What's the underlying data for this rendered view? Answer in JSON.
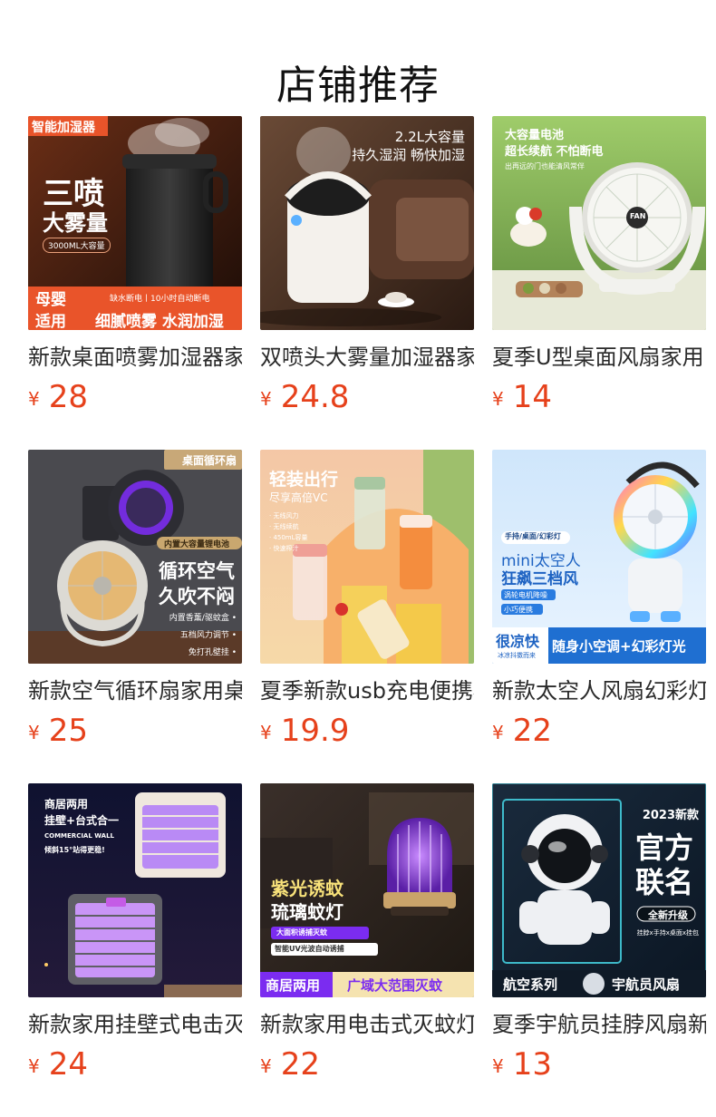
{
  "page": {
    "title": "店铺推荐"
  },
  "products": [
    {
      "name": "新款桌面喷雾加湿器家用",
      "currency": "¥",
      "price": "28",
      "image": {
        "tl": "智能加湿器",
        "big1": "三喷",
        "big2": "大雾量",
        "cap": "3000ML大容量",
        "badge1": "母婴",
        "badge2": "适用",
        "sub": "缺水断电丨10小时自动断电",
        "bottom": "细腻喷雾 水润加湿"
      }
    },
    {
      "name": "双喷头大雾量加湿器家用",
      "currency": "¥",
      "price": "24.8",
      "image": {
        "line1": "2.2L大容量",
        "line2": "持久湿润 畅快加湿"
      }
    },
    {
      "name": "夏季U型桌面风扇家用",
      "currency": "¥",
      "price": "14",
      "image": {
        "line1": "大容量电池",
        "line2": "超长续航 不怕断电",
        "line3": "出再远的门也能清风常伴",
        "fan": "FAN"
      }
    },
    {
      "name": "新款空气循环扇家用桌面",
      "currency": "¥",
      "price": "25",
      "image": {
        "tr": "桌面循环扇",
        "band": "内置大容量锂电池",
        "big1": "循环空气",
        "big2": "久吹不闷",
        "f1": "内置香薰/驱蚊盒 •",
        "f2": "五档风力调节 •",
        "f3": "免打孔壁挂 •"
      }
    },
    {
      "name": "夏季新款usb充电便携榨汁杯",
      "currency": "¥",
      "price": "19.9",
      "image": {
        "big": "轻装出行",
        "sub": "尽享高倍VC",
        "f1": "· 无线风力",
        "f2": "· 无线续航",
        "f3": "· 450mL容量",
        "f4": "· 快速榨汁"
      }
    },
    {
      "name": "新款太空人风扇幻彩灯光",
      "currency": "¥",
      "price": "22",
      "image": {
        "chip": "手持/桌面/幻彩灯",
        "big1": "mini太空人",
        "big2": "狂飙三档风",
        "b1": "涡轮电机降噪",
        "b2": "小巧便携",
        "cool1": "很凉快",
        "cool2": "冰凉抖擞而来",
        "bottom": "随身小空调+幻彩灯光"
      }
    },
    {
      "name": "新款家用挂壁式电击灭蚊灯",
      "currency": "¥",
      "price": "24",
      "image": {
        "line1": "商居两用",
        "line2": "挂壁+台式合一",
        "line3": "COMMERCIAL WALL",
        "line4": "倾斜15°站得更稳!"
      }
    },
    {
      "name": "新款家用电击式灭蚊灯",
      "currency": "¥",
      "price": "22",
      "image": {
        "big1": "紫光诱蚊",
        "big2": "琉璃蚊灯",
        "b1": "大面积诱捕灭蚊",
        "b2": "智能UV光波自动诱捕",
        "bl": "商居两用",
        "br": "广域大范围灭蚊"
      }
    },
    {
      "name": "夏季宇航员挂脖风扇新款",
      "currency": "¥",
      "price": "13",
      "image": {
        "year": "2023新款",
        "big1": "官方",
        "big2": "联名",
        "pill": "全新升级",
        "sub": "挂脖x手持x桌面x挂包",
        "bl": "航空系列",
        "br": "宇航员风扇"
      }
    }
  ],
  "colors": {
    "price": "#e6411b",
    "accent_orange": "#f0621f",
    "accent_purple": "#7b2cf0"
  }
}
